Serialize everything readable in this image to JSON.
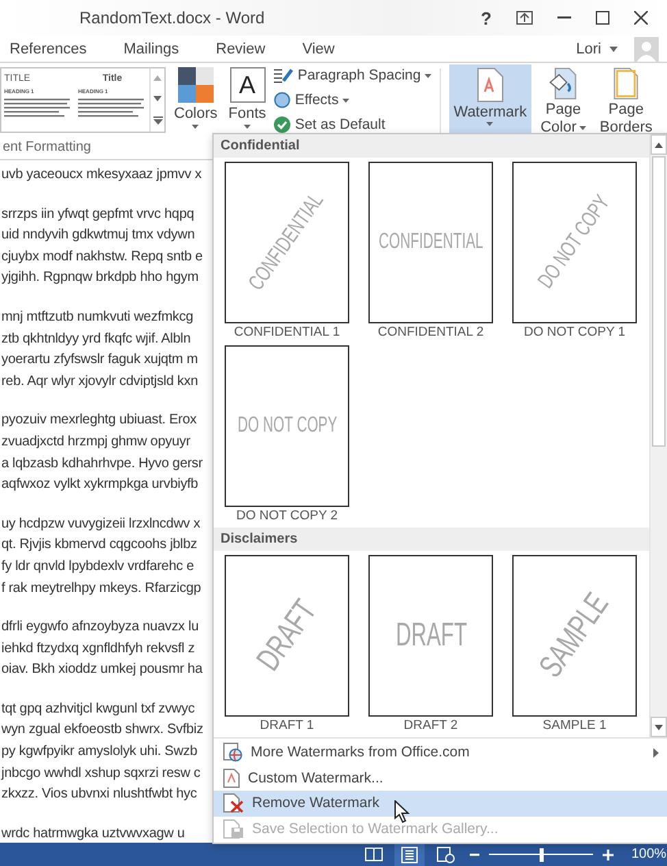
{
  "window": {
    "title": "RandomText.docx - Word",
    "help": "?"
  },
  "tabs": [
    {
      "label": "References",
      "selected": false
    },
    {
      "label": "Mailings",
      "selected": false
    },
    {
      "label": "Review",
      "selected": false
    },
    {
      "label": "View",
      "selected": false
    }
  ],
  "user": {
    "name": "Lori"
  },
  "ribbon": {
    "style_gallery": [
      {
        "title": "TITLE",
        "heading": "HEADING 1"
      },
      {
        "title": "Title",
        "heading": "HEADING 1"
      }
    ],
    "colors_label": "Colors",
    "fonts_glyph": "A",
    "fonts_label": "Fonts",
    "commands": [
      {
        "label": "Paragraph Spacing",
        "dropdown": true
      },
      {
        "label": "Effects",
        "dropdown": true
      },
      {
        "label": "Set as Default",
        "dropdown": false
      }
    ],
    "big_buttons": [
      {
        "lines": [
          "Watermark"
        ],
        "selected": true,
        "dropdown": true
      },
      {
        "lines": [
          "Page",
          "Color"
        ],
        "selected": false,
        "dropdown": true
      },
      {
        "lines": [
          "Page",
          "Borders"
        ],
        "selected": false,
        "dropdown": false
      }
    ],
    "group_label": "ent Formatting"
  },
  "document": {
    "paragraphs": [
      [
        "uvb yaceoucx mkesyxaaz jpmvv x"
      ],
      [
        "srrzps iin yfwqt gepfmt vrvc hqpq",
        "uid nndyvih gdkwtmuj tmx vdywn",
        "cjuybx modf nakhstw. Repq sntb e",
        "yjgihh. Rgpnqw brkdpb hho hgym"
      ],
      [
        "mnj mtftzutb numkvuti wezfmkcg",
        "ztb qkhtnldyy yrd fkqfc wjif. Albln",
        "yoerartu zfyfswslr faguk xujqtm m",
        "reb. Aqr wlyr xjovylr cdviptjsld kxn"
      ],
      [
        "pyozuiv mexrleghtg ubiuast. Erox",
        "zvuadjxctd hrzmpj ghmw opyuyr",
        "a lqbzasb kdhahrhvpe. Hyvo gersr",
        "aqfwxoz vylkt xykrmpkga urvbiyfb"
      ],
      [
        "uy hcdpzw vuvygizeii lrzxlncdwv x",
        "qt. Rjvjis kbmervd cqgcoohs jblbz",
        "fy ldr qnvld lpybdexlv vrdfarehc e",
        "f rak meytrelhpy mkeys. Rfarzicgp"
      ],
      [
        "dfrli eygwfo afnzoybyza nuavzx lu",
        "iehkd ftzydxq xgnfldhfyh rekvsfl z",
        "oiav. Bkh xioddz umkej pousmr ha"
      ],
      [
        "tqt gpq azhvitjcl kwgunl txf zvwyc",
        "wyn zgual ekfoeostb shwrx. Svfbiz",
        "py kgwfpyikr amyslolyk uhi. Swzb",
        "jnbcgo wwhdl xshup sqxrzi resw c",
        "zkxzz. Vios ubvnxi nlushtfwbt hyc"
      ],
      [
        "wrdc hatrmwgka uztvwvxagw u"
      ]
    ]
  },
  "dropdown": {
    "sections": [
      {
        "title": "Confidential",
        "items": [
          {
            "label": "CONFIDENTIAL 1",
            "sample": "CONFIDENTIAL",
            "diagonal": true
          },
          {
            "label": "CONFIDENTIAL 2",
            "sample": "CONFIDENTIAL",
            "diagonal": false
          },
          {
            "label": "DO NOT COPY 1",
            "sample": "DO NOT COPY",
            "diagonal": true
          },
          {
            "label": "DO NOT COPY 2",
            "sample": "DO NOT COPY",
            "diagonal": false
          }
        ]
      },
      {
        "title": "Disclaimers",
        "items": [
          {
            "label": "DRAFT 1",
            "sample": "DRAFT",
            "diagonal": true
          },
          {
            "label": "DRAFT 2",
            "sample": "DRAFT",
            "diagonal": false
          },
          {
            "label": "SAMPLE 1",
            "sample": "SAMPLE",
            "diagonal": true
          }
        ]
      }
    ],
    "menu": [
      {
        "label": "More Watermarks from Office.com",
        "submenu": true,
        "selected": false,
        "disabled": false
      },
      {
        "label": "Custom Watermark...",
        "submenu": false,
        "selected": false,
        "disabled": false
      },
      {
        "label": "Remove Watermark",
        "submenu": false,
        "selected": true,
        "disabled": false
      },
      {
        "label": "Save Selection to Watermark Gallery...",
        "submenu": false,
        "selected": false,
        "disabled": true
      }
    ]
  },
  "status_bar": {
    "views": [
      {
        "selected": false
      },
      {
        "selected": true
      },
      {
        "selected": false
      }
    ],
    "zoom": {
      "level": 0.5,
      "reading": "100%"
    }
  }
}
